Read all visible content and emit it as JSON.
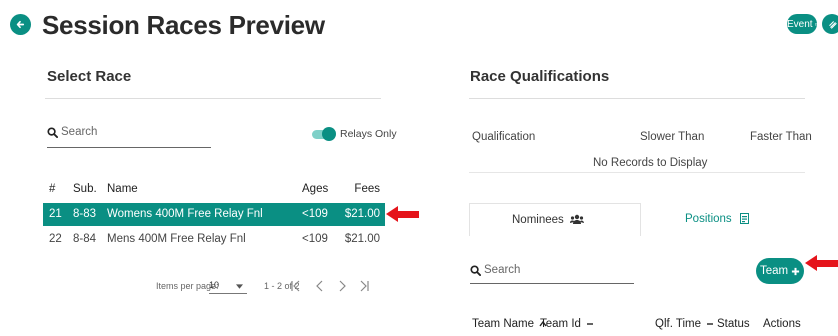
{
  "header": {
    "title": "Session Races Preview",
    "event_label": "Event"
  },
  "select_race": {
    "title": "Select Race",
    "search_placeholder": "Search",
    "relays_only_label": "Relays Only",
    "columns": [
      "#",
      "Sub.",
      "Name",
      "Ages",
      "Fees"
    ],
    "rows": [
      {
        "num": "21",
        "sub": "8-83",
        "name": "Womens 400M Free Relay Fnl",
        "ages": "<109",
        "fees": "$21.00"
      },
      {
        "num": "22",
        "sub": "8-84",
        "name": "Mens 400M Free Relay Fnl",
        "ages": "<109",
        "fees": "$21.00"
      }
    ],
    "pagination": {
      "items_per_page_label": "Items per page:",
      "items_per_page_value": "10",
      "range": "1 - 2 of 2"
    }
  },
  "race_qualifications": {
    "title": "Race Qualifications",
    "columns": [
      "Qualification",
      "Slower Than",
      "Faster Than"
    ],
    "empty_text": "No Records to Display",
    "tabs": [
      {
        "label": "Nominees"
      },
      {
        "label": "Positions"
      }
    ],
    "search_placeholder": "Search",
    "team_button_label": "Team",
    "team_columns": {
      "team_name": "Team Name",
      "team_id": "Team Id",
      "qlf_time": "Qlf. Time",
      "status": "Status",
      "actions": "Actions"
    }
  },
  "colors": {
    "accent": "#0a8f83",
    "annotation_arrow": "#e5141b"
  }
}
